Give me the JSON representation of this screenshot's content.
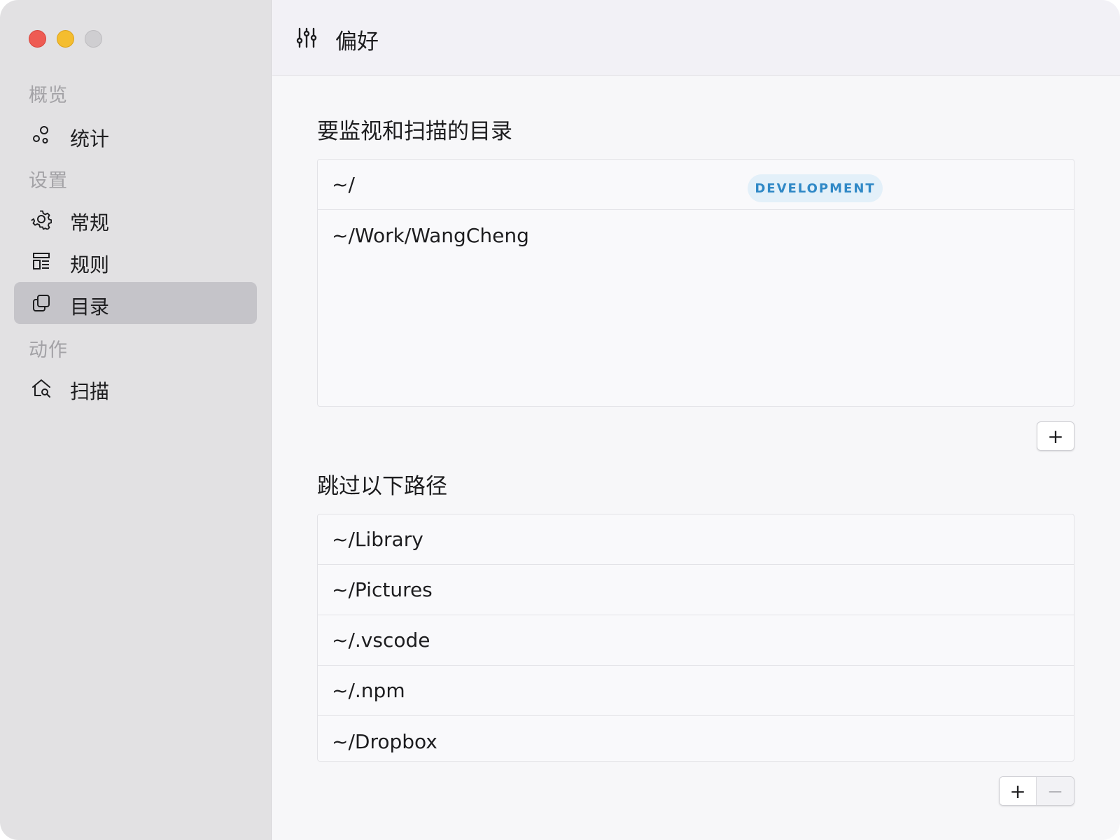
{
  "window": {
    "traffic_lights": [
      "close",
      "minimize",
      "maximize"
    ]
  },
  "sidebar": {
    "sections": [
      {
        "label": "概览",
        "items": [
          {
            "label": "统计",
            "icon": "stats-icon"
          }
        ]
      },
      {
        "label": "设置",
        "items": [
          {
            "label": "常规",
            "icon": "gear-icon"
          },
          {
            "label": "规则",
            "icon": "rules-icon"
          },
          {
            "label": "目录",
            "icon": "folders-icon"
          }
        ]
      },
      {
        "label": "动作",
        "items": [
          {
            "label": "扫描",
            "icon": "scan-home-icon"
          }
        ]
      }
    ],
    "selected": "目录"
  },
  "toolbar": {
    "title": "偏好",
    "icon": "sliders-icon"
  },
  "monitor": {
    "heading": "要监视和扫描的目录",
    "rows": [
      {
        "path": "~/",
        "badge": "DEVELOPMENT"
      },
      {
        "path": "~/Work/WangCheng"
      }
    ],
    "add_label": "+"
  },
  "skip": {
    "heading": "跳过以下路径",
    "rows": [
      "~/Library",
      "~/Pictures",
      "~/.vscode",
      "~/.npm",
      "~/Dropbox"
    ],
    "add_label": "+",
    "remove_label": "−"
  },
  "colors": {
    "badge_text": "#2f88c6",
    "badge_bg": "#e3f0f9",
    "selected_bg": "#c5c4c9",
    "close": "#ee5b53",
    "minimize": "#f4bd2f"
  }
}
